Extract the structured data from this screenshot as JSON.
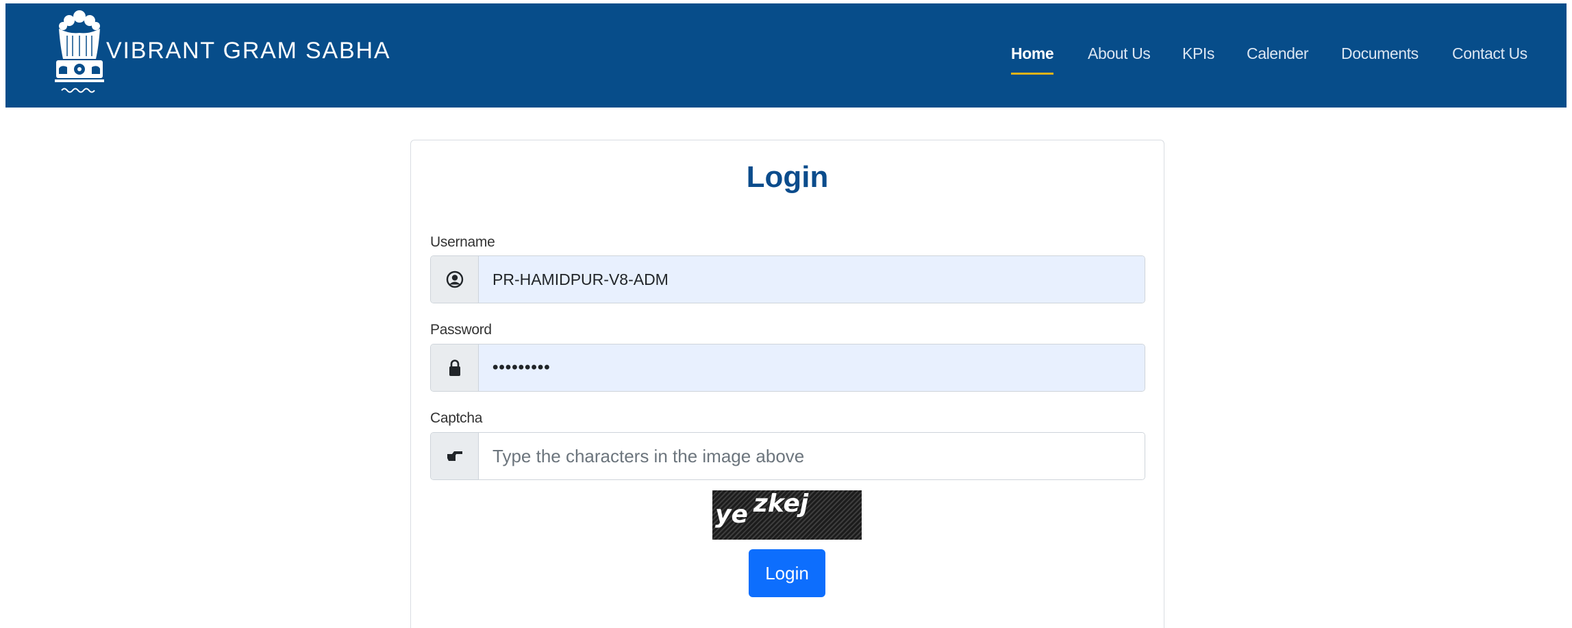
{
  "header": {
    "brand": "VIBRANT GRAM SABHA",
    "emblem_icon": "national-emblem-icon",
    "background_color": "#074d8a",
    "nav": {
      "home": "Home",
      "about": "About Us",
      "kpis": "KPIs",
      "calendar": "Calender",
      "documents": "Documents",
      "contact": "Contact Us"
    },
    "active_nav": "Home",
    "active_underline_color": "#e8b319"
  },
  "login": {
    "title": "Login",
    "username": {
      "label": "Username",
      "value": "PR-HAMIDPUR-V8-ADM",
      "icon": "user-circle-icon"
    },
    "password": {
      "label": "Password",
      "value": "•••••••••",
      "icon": "lock-icon"
    },
    "captcha": {
      "label": "Captcha",
      "placeholder": "Type the characters in the image above",
      "icon": "hand-pointer-icon",
      "image_text_1": "ye",
      "image_text_2": "zkej"
    },
    "button_label": "Login",
    "button_color": "#0d6efd"
  }
}
